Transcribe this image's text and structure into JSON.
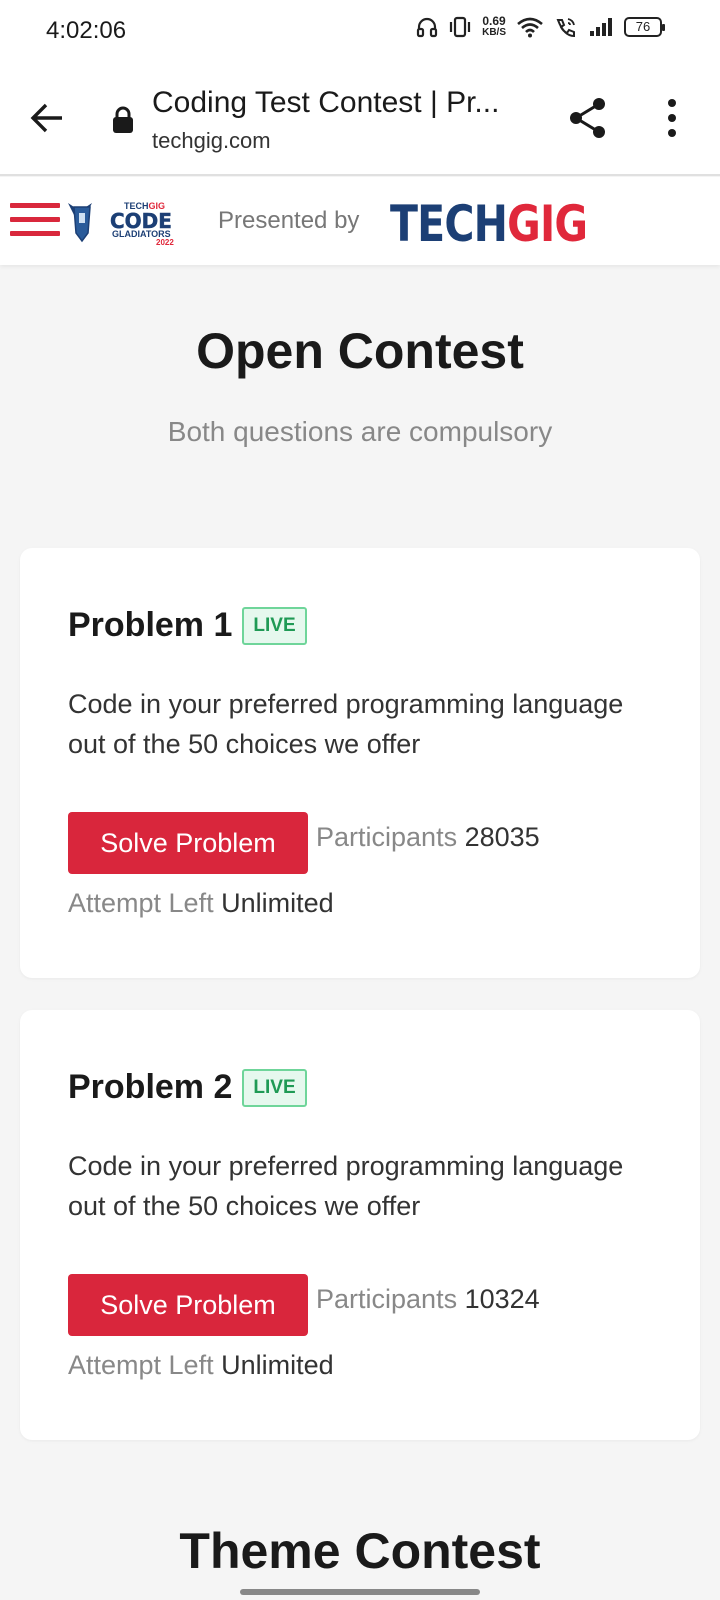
{
  "status_bar": {
    "time": "4:02:06",
    "speed_value": "0.69",
    "speed_unit": "KB/S",
    "battery": "76"
  },
  "browser": {
    "title": "Coding Test Contest | Pr...",
    "url": "techgig.com"
  },
  "site_header": {
    "presented_by": "Presented by",
    "brand_part1": "TECH",
    "brand_part2": "GIG",
    "brand_color_blue": "#1c3f75",
    "brand_color_red": "#e0283b"
  },
  "open_contest": {
    "title": "Open Contest",
    "subtitle": "Both questions are compulsory",
    "problems": [
      {
        "title": "Problem 1",
        "badge": "LIVE",
        "description": "Code in your preferred programming language out of the 50 choices we offer",
        "button": "Solve Problem",
        "participants_label": "Participants",
        "participants_value": "28035",
        "attempts_label": "Attempt Left",
        "attempts_value": "Unlimited"
      },
      {
        "title": "Problem 2",
        "badge": "LIVE",
        "description": "Code in your preferred programming language out of the 50 choices we offer",
        "button": "Solve Problem",
        "participants_label": "Participants",
        "participants_value": "10324",
        "attempts_label": "Attempt Left",
        "attempts_value": "Unlimited"
      }
    ]
  },
  "theme_contest": {
    "title": "Theme Contest"
  },
  "colors": {
    "accent_red": "#d9263c",
    "live_green": "#1f9a55"
  }
}
